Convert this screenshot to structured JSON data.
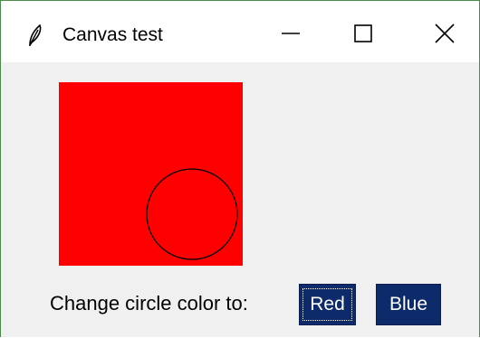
{
  "window": {
    "title": "Canvas test",
    "icon": "feather-icon",
    "controls": {
      "minimize_icon": "minimize-icon",
      "maximize_icon": "maximize-icon",
      "close_icon": "close-icon"
    }
  },
  "canvas": {
    "background_color": "#ff0000",
    "circle": {
      "fill": "none",
      "outline_color": "#000000"
    }
  },
  "controls": {
    "prompt": "Change circle color to:",
    "buttons": [
      {
        "label": "Red",
        "focused": true,
        "color": "#0d2a6b"
      },
      {
        "label": "Blue",
        "focused": false,
        "color": "#0d2a6b"
      }
    ]
  }
}
